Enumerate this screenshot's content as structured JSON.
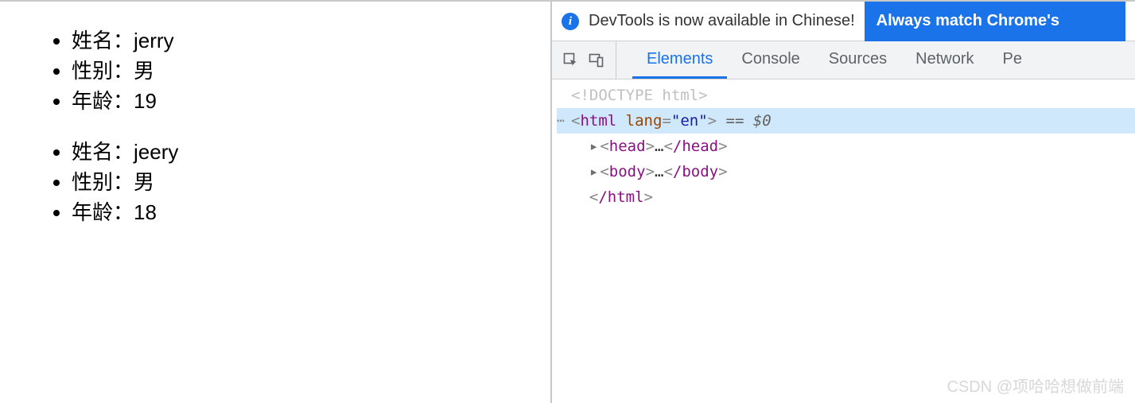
{
  "page": {
    "persons": [
      {
        "name_label": "姓名：",
        "name_value": "jerry",
        "gender_label": "性别：",
        "gender_value": "男",
        "age_label": "年龄：",
        "age_value": "19"
      },
      {
        "name_label": "姓名：",
        "name_value": "jeery",
        "gender_label": "性别：",
        "gender_value": "男",
        "age_label": "年龄：",
        "age_value": "18"
      }
    ]
  },
  "devtools": {
    "banner": {
      "text": "DevTools is now available in Chinese!",
      "button_label": "Always match Chrome's"
    },
    "tabs": {
      "elements": "Elements",
      "console": "Console",
      "sources": "Sources",
      "network": "Network",
      "more": "Pe"
    },
    "dom": {
      "doctype": "<!DOCTYPE html>",
      "html_open": {
        "tag": "html",
        "attr": "lang",
        "val": "\"en\"",
        "sel": " == $0"
      },
      "head": {
        "tag_open": "head",
        "ellipsis": "…",
        "tag_close": "/head"
      },
      "body": {
        "tag_open": "body",
        "ellipsis": "…",
        "tag_close": "/body"
      },
      "html_close": "/html"
    }
  },
  "watermark": "CSDN @项哈哈想做前端"
}
